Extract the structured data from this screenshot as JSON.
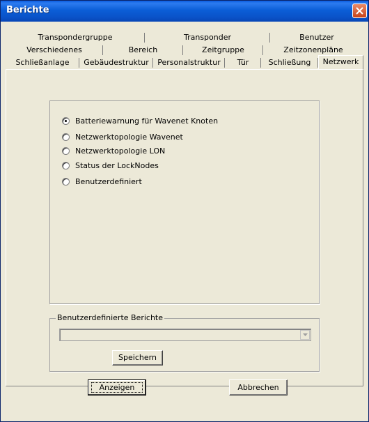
{
  "window": {
    "title": "Berichte"
  },
  "tabs": {
    "row1": [
      "Transpondergruppe",
      "Transponder",
      "Benutzer"
    ],
    "row2": [
      "Verschiedenes",
      "Bereich",
      "Zeitgruppe",
      "Zeitzonenpläne"
    ],
    "row3": [
      "Schließanlage",
      "Gebäudestruktur",
      "Personalstruktur",
      "Tür",
      "Schließung",
      "Netzwerk"
    ],
    "active": "Netzwerk"
  },
  "reports": {
    "options": [
      {
        "label": "Batteriewarnung für Wavenet Knoten",
        "checked": true
      },
      {
        "label": "Netzwerktopologie Wavenet",
        "checked": false
      },
      {
        "label": "Netzwerktopologie LON",
        "checked": false
      },
      {
        "label": "Status der LockNodes",
        "checked": false
      },
      {
        "label": "Benutzerdefiniert",
        "checked": false
      }
    ]
  },
  "custom_reports": {
    "legend": "Benutzerdefinierte Berichte",
    "selected_value": "",
    "save_label": "Speichern"
  },
  "footer": {
    "show_label": "Anzeigen",
    "cancel_label": "Abbrechen"
  }
}
